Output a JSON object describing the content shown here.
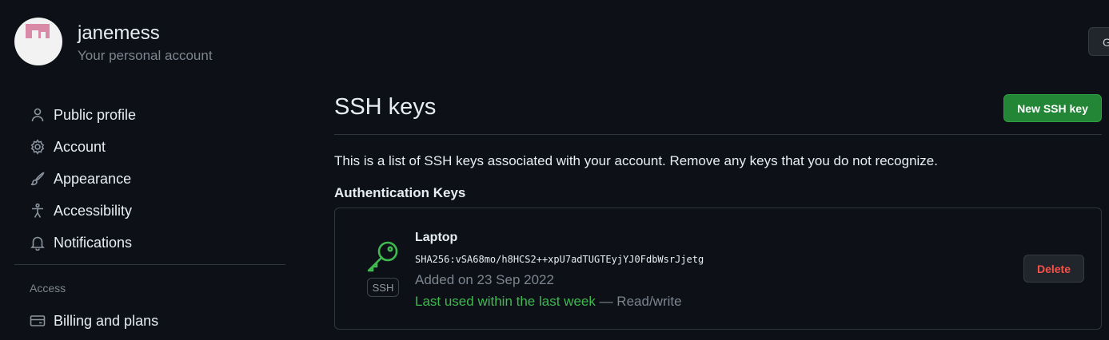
{
  "account": {
    "username": "janemess",
    "subtitle": "Your personal account",
    "goto_label": "G"
  },
  "sidebar": {
    "items": [
      {
        "label": "Public profile",
        "icon": "person-icon"
      },
      {
        "label": "Account",
        "icon": "gear-icon"
      },
      {
        "label": "Appearance",
        "icon": "paintbrush-icon"
      },
      {
        "label": "Accessibility",
        "icon": "accessibility-icon"
      },
      {
        "label": "Notifications",
        "icon": "bell-icon"
      }
    ],
    "access_heading": "Access",
    "access_items": [
      {
        "label": "Billing and plans",
        "icon": "credit-card-icon"
      }
    ]
  },
  "main": {
    "title": "SSH keys",
    "new_key_label": "New SSH key",
    "description": "This is a list of SSH keys associated with your account. Remove any keys that you do not recognize.",
    "section_heading": "Authentication Keys",
    "keys": [
      {
        "title": "Laptop",
        "fingerprint": "SHA256:vSA68mo/h8HCS2++xpU7adTUGTEyjYJ0FdbWsrJjetg",
        "added": "Added on 23 Sep 2022",
        "last_used": "Last used within the last week",
        "access": " — Read/write",
        "badge": "SSH",
        "delete_label": "Delete",
        "icon": "key-icon"
      }
    ]
  },
  "colors": {
    "background": "#0d1117",
    "primary_button": "#238636",
    "danger": "#f85149",
    "success_text": "#3fb950"
  }
}
